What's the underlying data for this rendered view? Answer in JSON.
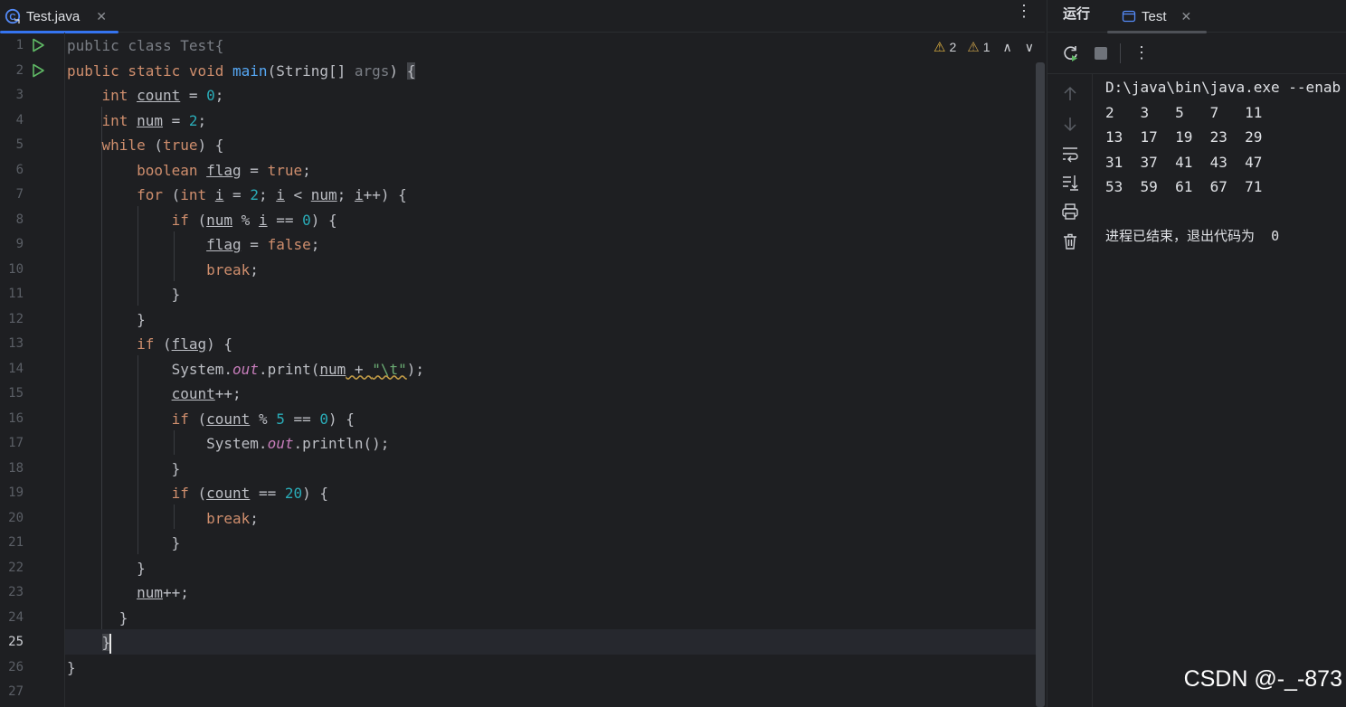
{
  "editor": {
    "tab_title": "Test.java",
    "tab_close": "✕",
    "menu_icon": "⋮",
    "inspections": {
      "warnings": "2",
      "weak_warnings": "1"
    },
    "current_line": "25",
    "line_numbers": [
      "1",
      "2",
      "3",
      "4",
      "5",
      "6",
      "7",
      "8",
      "9",
      "10",
      "11",
      "12",
      "13",
      "14",
      "15",
      "16",
      "17",
      "18",
      "19",
      "20",
      "21",
      "22",
      "23",
      "24",
      "25",
      "26",
      "27"
    ],
    "code_lines": [
      "public class Test{",
      "public static void main(String[] args) {",
      "    int count = 0;",
      "    int num = 2;",
      "    while (true) {",
      "        boolean flag = true;",
      "        for (int i = 2; i < num; i++) {",
      "            if (num % i == 0) {",
      "                flag = false;",
      "                break;",
      "            }",
      "        }",
      "        if (flag) {",
      "            System.out.print(num + \"\\t\");",
      "            count++;",
      "            if (count % 5 == 0) {",
      "                System.out.println();",
      "            }",
      "            if (count == 20) {",
      "                break;",
      "            }",
      "        }",
      "        num++;",
      "      }",
      "    }",
      "}",
      ""
    ]
  },
  "run_panel": {
    "title": "运行",
    "tab_label": "Test",
    "tab_close": "✕",
    "toolbar_more": "⋮",
    "console_lines": [
      "D:\\java\\bin\\java.exe --enab",
      "2   3   5   7   11",
      "13  17  19  23  29",
      "31  37  41  43  47",
      "53  59  61  67  71",
      "",
      "进程已结束，退出代码为  0"
    ]
  },
  "watermark": "CSDN @-_-873",
  "colors": {
    "accent": "#3574f0",
    "run_green": "#5fb865",
    "keyword": "#cf8e6d",
    "number": "#2aacb8",
    "string": "#6aab73",
    "method": "#56a8f5",
    "static_field": "#c77dbb"
  },
  "icons": [
    "java-class-icon",
    "run-gutter-icon",
    "rerun-icon",
    "stop-icon",
    "scroll-up-icon",
    "scroll-down-icon",
    "soft-wrap-icon",
    "scroll-to-end-icon",
    "print-icon",
    "trash-icon",
    "console-tab-icon",
    "warning-icon"
  ]
}
